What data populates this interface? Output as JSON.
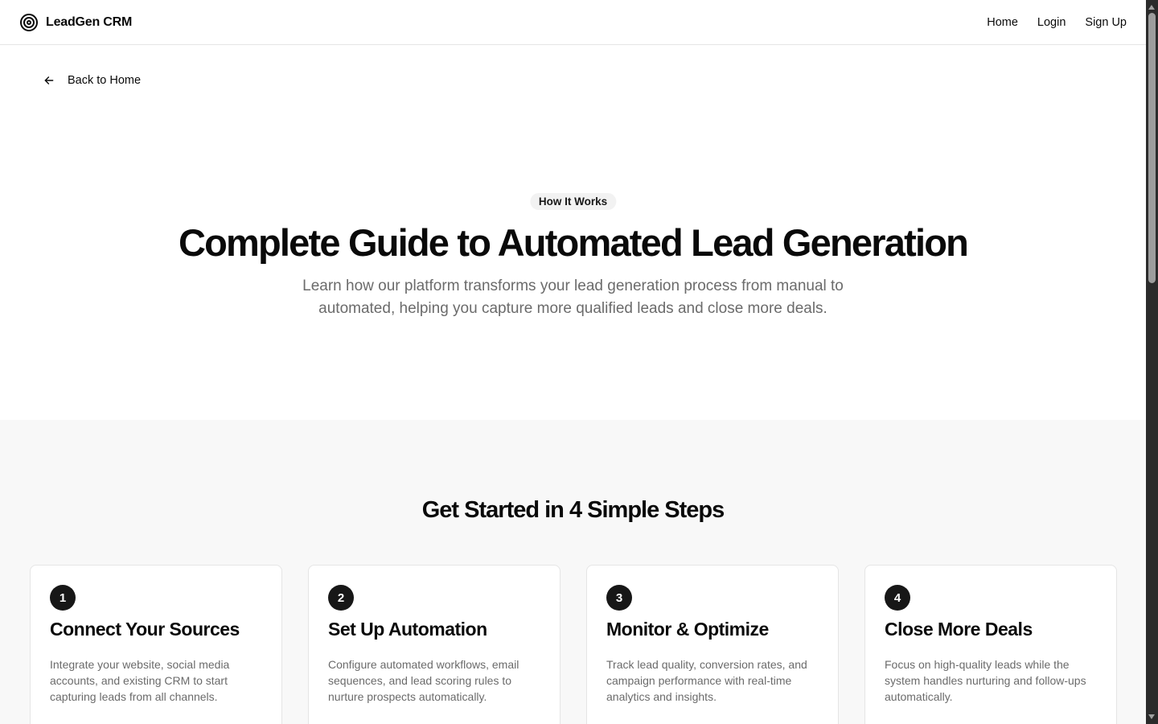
{
  "header": {
    "brand": "LeadGen CRM",
    "nav": [
      "Home",
      "Login",
      "Sign Up"
    ]
  },
  "back_link": {
    "label": "Back to Home"
  },
  "hero": {
    "badge": "How It Works",
    "title": "Complete Guide to Automated Lead Generation",
    "subtitle": "Learn how our platform transforms your lead generation process from manual to automated, helping you capture more qualified leads and close more deals."
  },
  "steps": {
    "title": "Get Started in 4 Simple Steps",
    "items": [
      {
        "number": "1",
        "title": "Connect Your Sources",
        "description": "Integrate your website, social media accounts, and existing CRM to start capturing leads from all channels."
      },
      {
        "number": "2",
        "title": "Set Up Automation",
        "description": "Configure automated workflows, email sequences, and lead scoring rules to nurture prospects automatically."
      },
      {
        "number": "3",
        "title": "Monitor & Optimize",
        "description": "Track lead quality, conversion rates, and campaign performance with real-time analytics and insights."
      },
      {
        "number": "4",
        "title": "Close More Deals",
        "description": "Focus on high-quality leads while the system handles nurturing and follow-ups automatically."
      }
    ]
  },
  "icons": {
    "brand": "target-icon",
    "back": "arrow-left-icon"
  },
  "colors": {
    "text": "#0a0a0a",
    "muted": "#6b6b6b",
    "section_bg": "#f8f8f8",
    "badge_bg": "#f2f2f2",
    "step_badge": "#171717"
  }
}
